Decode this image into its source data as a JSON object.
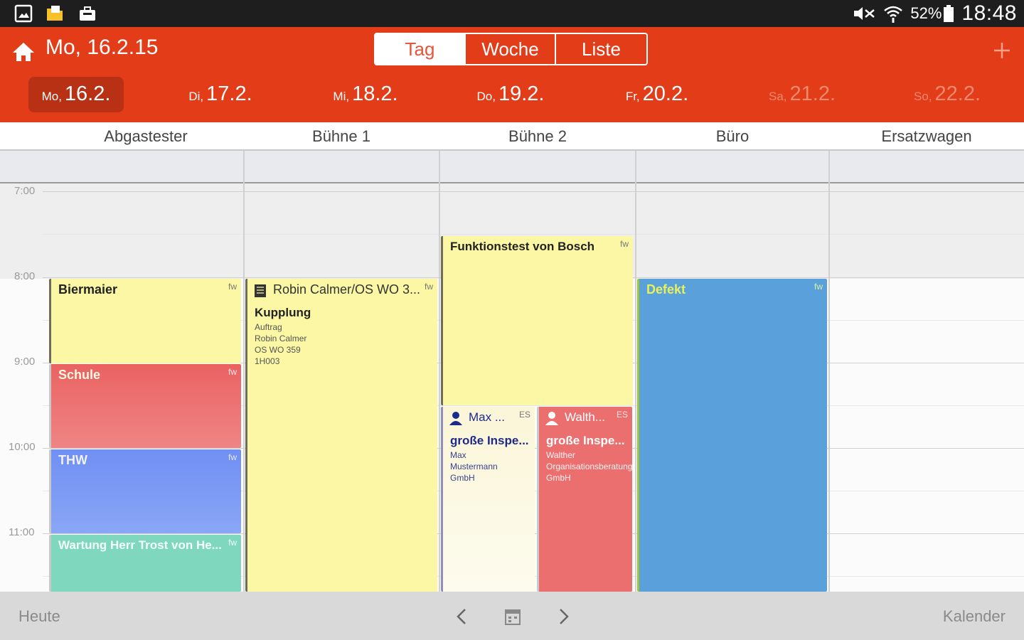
{
  "status_bar": {
    "left_icons": [
      "gallery-icon",
      "folder-icon",
      "briefcase-icon"
    ],
    "battery_text": "52%",
    "time": "18:48"
  },
  "header": {
    "current_date": "Mo, 16.2.15",
    "view_tabs": [
      {
        "label": "Tag",
        "active": true
      },
      {
        "label": "Woche",
        "active": false
      },
      {
        "label": "Liste",
        "active": false
      }
    ],
    "add_icon": "plus-icon",
    "home_icon": "home-icon",
    "days": [
      {
        "weekday": "Mo,",
        "date": "16.2.",
        "selected": true,
        "weekend": false
      },
      {
        "weekday": "Di,",
        "date": "17.2.",
        "selected": false,
        "weekend": false
      },
      {
        "weekday": "Mi,",
        "date": "18.2.",
        "selected": false,
        "weekend": false
      },
      {
        "weekday": "Do,",
        "date": "19.2.",
        "selected": false,
        "weekend": false
      },
      {
        "weekday": "Fr,",
        "date": "20.2.",
        "selected": false,
        "weekend": false
      },
      {
        "weekday": "Sa,",
        "date": "21.2.",
        "selected": false,
        "weekend": true
      },
      {
        "weekday": "So,",
        "date": "22.2.",
        "selected": false,
        "weekend": true
      }
    ]
  },
  "resources": [
    "Abgastester",
    "Bühne 1",
    "Bühne 2",
    "Büro",
    "Ersatzwagen"
  ],
  "time_labels": [
    "7:00",
    "8:00",
    "9:00",
    "10:00",
    "11:00"
  ],
  "events": {
    "biermaier": {
      "title": "Biermaier",
      "tag": "fw"
    },
    "schule": {
      "title": "Schule",
      "tag": "fw"
    },
    "thw": {
      "title": "THW",
      "tag": "fw"
    },
    "wartung": {
      "title": "Wartung Herr Trost von He...",
      "tag": "fw"
    },
    "robin": {
      "title": "Robin Calmer/OS WO 3...",
      "tag": "fw",
      "subtitle": "Kupplung",
      "lines": [
        "Auftrag",
        "Robin Calmer",
        "OS WO 359",
        "1H003"
      ]
    },
    "bosch": {
      "title": "Funktionstest von Bosch",
      "tag": "fw"
    },
    "max": {
      "title": "Max ...",
      "tag": "ES",
      "subtitle": "große Inspe...",
      "lines": [
        "Max",
        "Mustermann",
        "GmbH"
      ]
    },
    "walther": {
      "title": "Walth...",
      "tag": "ES",
      "subtitle": "große Inspe...",
      "lines": [
        "Walther",
        "Organisationsberatung",
        "GmbH"
      ]
    },
    "defekt": {
      "title": "Defekt",
      "tag": "fw"
    }
  },
  "colors": {
    "header": "#e23c19",
    "yellow_event": "#fbf7a4",
    "red_event": "#ec6f6f",
    "blue_event": "#7f9cf5",
    "green_event": "#7fd8bd",
    "office_blue": "#5aa0db",
    "pale_event": "#fbf6d8"
  },
  "bottom_bar": {
    "today": "Heute",
    "calendar": "Kalender",
    "prev_icon": "chevron-left-icon",
    "date_picker_icon": "calendar-icon",
    "next_icon": "chevron-right-icon"
  }
}
